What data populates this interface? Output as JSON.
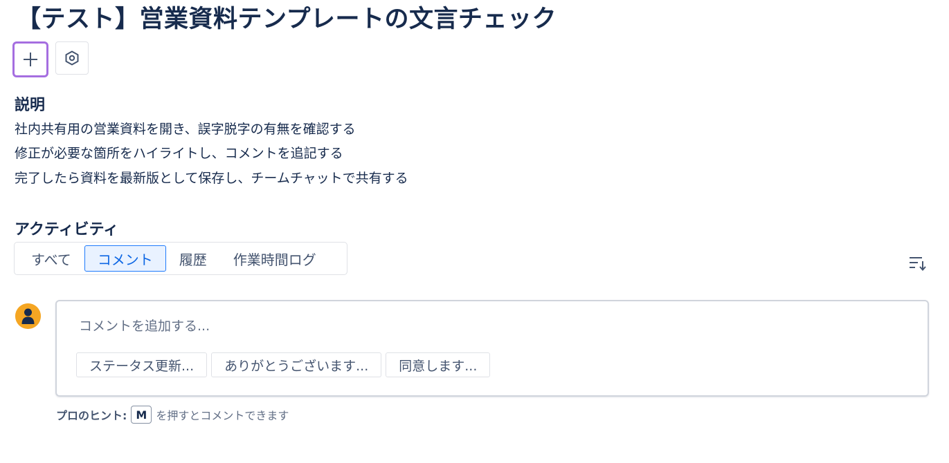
{
  "page": {
    "title": "【テスト】営業資料テンプレートの文言チェック"
  },
  "toolbar": {
    "add_icon": "plus-icon",
    "settings_icon": "hexagon-settings-icon",
    "accent_color": "#a56ee0"
  },
  "description": {
    "heading": "説明",
    "lines": [
      "社内共有用の営業資料を開き、誤字脱字の有無を確認する",
      "修正が必要な箇所をハイライトし、コメントを追記する",
      "完了したら資料を最新版として保存し、チームチャットで共有する"
    ]
  },
  "activity": {
    "heading": "アクティビティ",
    "tabs": [
      {
        "label": "すべて",
        "active": false
      },
      {
        "label": "コメント",
        "active": true
      },
      {
        "label": "履歴",
        "active": false
      },
      {
        "label": "作業時間ログ",
        "active": false
      }
    ],
    "sort_icon": "sort-order-icon"
  },
  "comment": {
    "avatar_icon": "user-avatar-icon",
    "avatar_color": "#f5a623",
    "placeholder": "コメントを追加する...",
    "quick_replies": [
      "ステータス更新...",
      "ありがとうございます...",
      "同意します..."
    ]
  },
  "pro_tip": {
    "label": "プロのヒント:",
    "key": "M",
    "text": "を押すとコメントできます"
  }
}
